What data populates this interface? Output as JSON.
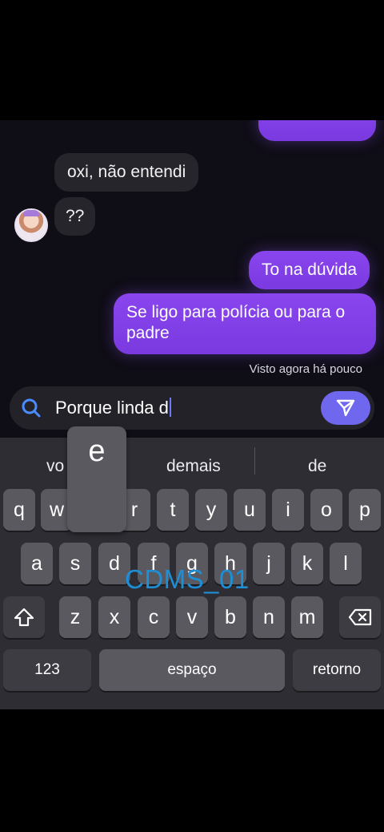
{
  "chat": {
    "incoming": [
      {
        "text": "oxi, não entendi"
      },
      {
        "text": "??"
      }
    ],
    "outgoing": [
      {
        "text": "To na dúvida"
      },
      {
        "text_line1": "Se ligo para polícia ou para o",
        "text_line2": "padre"
      }
    ],
    "seen_status": "Visto agora há pouco"
  },
  "composer": {
    "text": "Porque linda d"
  },
  "keyboard": {
    "suggestions": [
      "vo",
      "demais",
      "de"
    ],
    "popup_key": "e",
    "rows": [
      [
        "q",
        "w",
        "e",
        "r",
        "t",
        "y",
        "u",
        "i",
        "o",
        "p"
      ],
      [
        "a",
        "s",
        "d",
        "f",
        "g",
        "h",
        "j",
        "k",
        "l"
      ],
      [
        "z",
        "x",
        "c",
        "v",
        "b",
        "n",
        "m"
      ]
    ],
    "numbers_label": "123",
    "space_label": "espaço",
    "return_label": "retorno"
  },
  "watermark": "CDMS_01",
  "colors": {
    "outgoing_bubble": "#8a45ee",
    "incoming_bubble": "#26252b",
    "send_button": "#6f68ee",
    "keyboard_bg": "#2e2d33"
  },
  "icons": [
    "search-icon",
    "send-icon",
    "shift-icon",
    "backspace-icon"
  ]
}
